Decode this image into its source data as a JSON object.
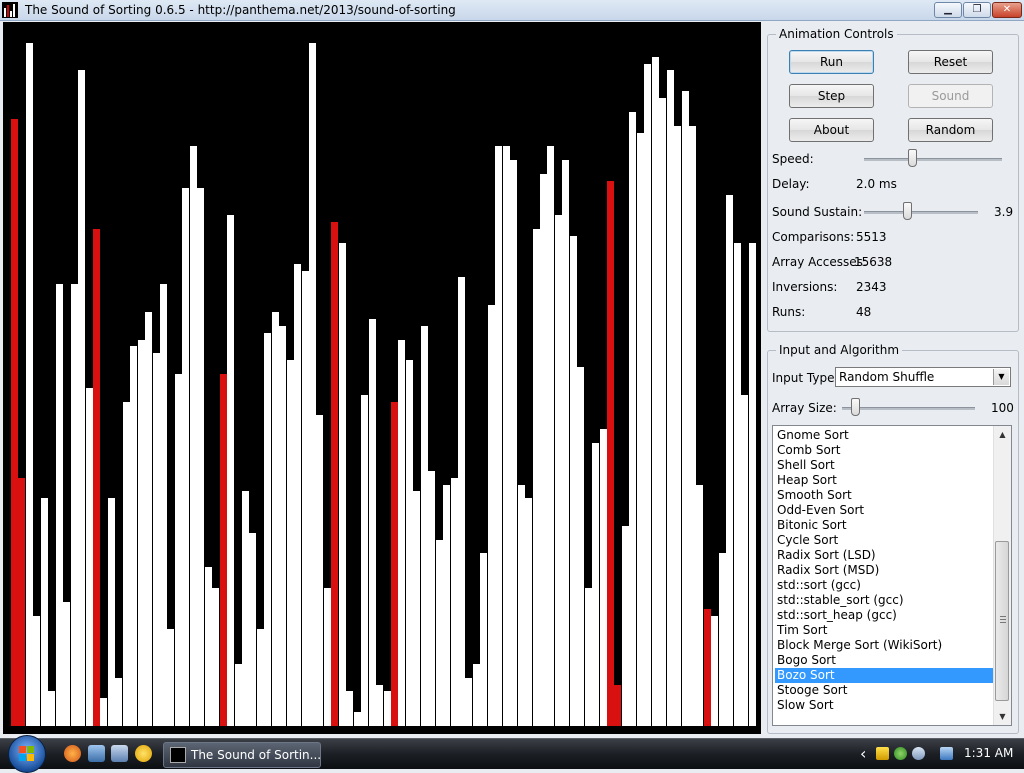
{
  "window": {
    "title": "The Sound of Sorting 0.6.5 - http://panthema.net/2013/sound-of-sorting",
    "minimize_glyph": "▁",
    "maximize_glyph": "❐",
    "close_glyph": "✕"
  },
  "array_display": {
    "colors": {
      "normal": "#ffffff",
      "highlight": "#d91010",
      "background": "#000000"
    },
    "bars": [
      {
        "h": 0.88,
        "hl": true
      },
      {
        "h": 0.36,
        "hl": true
      },
      {
        "h": 0.99,
        "hl": false
      },
      {
        "h": 0.16,
        "hl": false
      },
      {
        "h": 0.33,
        "hl": false
      },
      {
        "h": 0.05,
        "hl": false
      },
      {
        "h": 0.64,
        "hl": false
      },
      {
        "h": 0.18,
        "hl": false
      },
      {
        "h": 0.64,
        "hl": false
      },
      {
        "h": 0.95,
        "hl": false
      },
      {
        "h": 0.49,
        "hl": false
      },
      {
        "h": 0.72,
        "hl": true
      },
      {
        "h": 0.04,
        "hl": false
      },
      {
        "h": 0.33,
        "hl": false
      },
      {
        "h": 0.07,
        "hl": false
      },
      {
        "h": 0.47,
        "hl": false
      },
      {
        "h": 0.55,
        "hl": false
      },
      {
        "h": 0.56,
        "hl": false
      },
      {
        "h": 0.6,
        "hl": false
      },
      {
        "h": 0.54,
        "hl": false
      },
      {
        "h": 0.64,
        "hl": false
      },
      {
        "h": 0.14,
        "hl": false
      },
      {
        "h": 0.51,
        "hl": false
      },
      {
        "h": 0.78,
        "hl": false
      },
      {
        "h": 0.84,
        "hl": false
      },
      {
        "h": 0.78,
        "hl": false
      },
      {
        "h": 0.23,
        "hl": false
      },
      {
        "h": 0.2,
        "hl": false
      },
      {
        "h": 0.51,
        "hl": true
      },
      {
        "h": 0.74,
        "hl": false
      },
      {
        "h": 0.09,
        "hl": false
      },
      {
        "h": 0.34,
        "hl": false
      },
      {
        "h": 0.28,
        "hl": false
      },
      {
        "h": 0.14,
        "hl": false
      },
      {
        "h": 0.57,
        "hl": false
      },
      {
        "h": 0.6,
        "hl": false
      },
      {
        "h": 0.58,
        "hl": false
      },
      {
        "h": 0.53,
        "hl": false
      },
      {
        "h": 0.67,
        "hl": false
      },
      {
        "h": 0.66,
        "hl": false
      },
      {
        "h": 0.99,
        "hl": false
      },
      {
        "h": 0.45,
        "hl": false
      },
      {
        "h": 0.2,
        "hl": false
      },
      {
        "h": 0.73,
        "hl": true
      },
      {
        "h": 0.7,
        "hl": false
      },
      {
        "h": 0.05,
        "hl": false
      },
      {
        "h": 0.02,
        "hl": false
      },
      {
        "h": 0.48,
        "hl": false
      },
      {
        "h": 0.59,
        "hl": false
      },
      {
        "h": 0.06,
        "hl": false
      },
      {
        "h": 0.05,
        "hl": false
      },
      {
        "h": 0.47,
        "hl": true
      },
      {
        "h": 0.56,
        "hl": false
      },
      {
        "h": 0.53,
        "hl": false
      },
      {
        "h": 0.34,
        "hl": false
      },
      {
        "h": 0.58,
        "hl": false
      },
      {
        "h": 0.37,
        "hl": false
      },
      {
        "h": 0.27,
        "hl": false
      },
      {
        "h": 0.35,
        "hl": false
      },
      {
        "h": 0.36,
        "hl": false
      },
      {
        "h": 0.65,
        "hl": false
      },
      {
        "h": 0.07,
        "hl": false
      },
      {
        "h": 0.09,
        "hl": false
      },
      {
        "h": 0.25,
        "hl": false
      },
      {
        "h": 0.61,
        "hl": false
      },
      {
        "h": 0.84,
        "hl": false
      },
      {
        "h": 0.84,
        "hl": false
      },
      {
        "h": 0.82,
        "hl": false
      },
      {
        "h": 0.35,
        "hl": false
      },
      {
        "h": 0.33,
        "hl": false
      },
      {
        "h": 0.72,
        "hl": false
      },
      {
        "h": 0.8,
        "hl": false
      },
      {
        "h": 0.84,
        "hl": false
      },
      {
        "h": 0.74,
        "hl": false
      },
      {
        "h": 0.82,
        "hl": false
      },
      {
        "h": 0.71,
        "hl": false
      },
      {
        "h": 0.52,
        "hl": false
      },
      {
        "h": 0.2,
        "hl": false
      },
      {
        "h": 0.41,
        "hl": false
      },
      {
        "h": 0.43,
        "hl": false
      },
      {
        "h": 0.79,
        "hl": true
      },
      {
        "h": 0.06,
        "hl": true
      },
      {
        "h": 0.29,
        "hl": false
      },
      {
        "h": 0.89,
        "hl": false
      },
      {
        "h": 0.86,
        "hl": false
      },
      {
        "h": 0.96,
        "hl": false
      },
      {
        "h": 0.97,
        "hl": false
      },
      {
        "h": 0.91,
        "hl": false
      },
      {
        "h": 0.95,
        "hl": false
      },
      {
        "h": 0.87,
        "hl": false
      },
      {
        "h": 0.92,
        "hl": false
      },
      {
        "h": 0.87,
        "hl": false
      },
      {
        "h": 0.35,
        "hl": false
      },
      {
        "h": 0.17,
        "hl": true
      },
      {
        "h": 0.16,
        "hl": false
      },
      {
        "h": 0.25,
        "hl": false
      },
      {
        "h": 0.77,
        "hl": false
      },
      {
        "h": 0.7,
        "hl": false
      },
      {
        "h": 0.48,
        "hl": false
      },
      {
        "h": 0.7,
        "hl": false
      }
    ]
  },
  "animation_controls": {
    "title": "Animation Controls",
    "buttons": {
      "run": "Run",
      "reset": "Reset",
      "step": "Step",
      "sound": "Sound",
      "about": "About",
      "random": "Random"
    },
    "speed_label": "Speed:",
    "speed_level": 0.35,
    "delay_label": "Delay:",
    "delay_value": "2.0 ms",
    "sustain_label": "Sound Sustain:",
    "sustain_level": 0.38,
    "sustain_value": "3.9",
    "stats": [
      {
        "label": "Comparisons:",
        "value": "5513"
      },
      {
        "label": "Array Accesses:",
        "value": "15638"
      },
      {
        "label": "Inversions:",
        "value": "2343"
      },
      {
        "label": "Runs:",
        "value": "48"
      }
    ]
  },
  "input_algorithm": {
    "title": "Input and Algorithm",
    "input_type_label": "Input Type:",
    "input_type_value": "Random Shuffle",
    "array_size_label": "Array Size:",
    "array_size_level": 0.1,
    "array_size_value": "100",
    "algorithms": [
      "Gnome Sort",
      "Comb Sort",
      "Shell Sort",
      "Heap Sort",
      "Smooth Sort",
      "Odd-Even Sort",
      "Bitonic Sort",
      "Cycle Sort",
      "Radix Sort (LSD)",
      "Radix Sort (MSD)",
      "std::sort (gcc)",
      "std::stable_sort (gcc)",
      "std::sort_heap (gcc)",
      "Tim Sort",
      "Block Merge Sort (WikiSort)",
      "Bogo Sort",
      "Bozo Sort",
      "Stooge Sort",
      "Slow Sort"
    ],
    "selected_algorithm": "Bozo Sort"
  },
  "taskbar": {
    "task_title": "The Sound of Sortin...",
    "tray_chevron": "‹",
    "clock": "1:31 AM"
  }
}
